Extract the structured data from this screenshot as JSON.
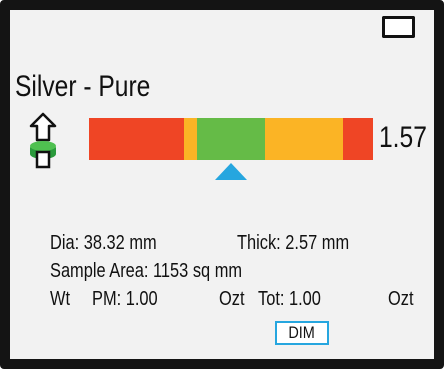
{
  "status": {
    "battery_icon": "battery-icon",
    "battery_color": "#45b439"
  },
  "measurement": {
    "metal": "Silver - Pure",
    "reading": "1.57",
    "icon": "coin-flip-icon",
    "scale": {
      "segments": [
        {
          "color": "#ef4525",
          "weight": 33.5
        },
        {
          "color": "#fbb425",
          "weight": 4.5
        },
        {
          "color": "#65bb47",
          "weight": 24
        },
        {
          "color": "#fbb425",
          "weight": 27.5
        },
        {
          "color": "#ef4525",
          "weight": 10.5
        }
      ],
      "pointer_position": 0.5,
      "pointer_color": "#26a6df"
    }
  },
  "details": {
    "dia_label": "Dia:",
    "dia_value": "38.32 mm",
    "thick_label": "Thick:",
    "thick_value": "2.57 mm",
    "area_label": "Sample Area:",
    "area_value": "1153 sq mm",
    "wt_label": "Wt",
    "pm_label": "PM:",
    "pm_value": "1.00",
    "pm_unit": "Ozt",
    "tot_label": "Tot:",
    "tot_value": "1.00",
    "tot_unit": "Ozt"
  },
  "buttons": {
    "dim_label": "DIM"
  }
}
